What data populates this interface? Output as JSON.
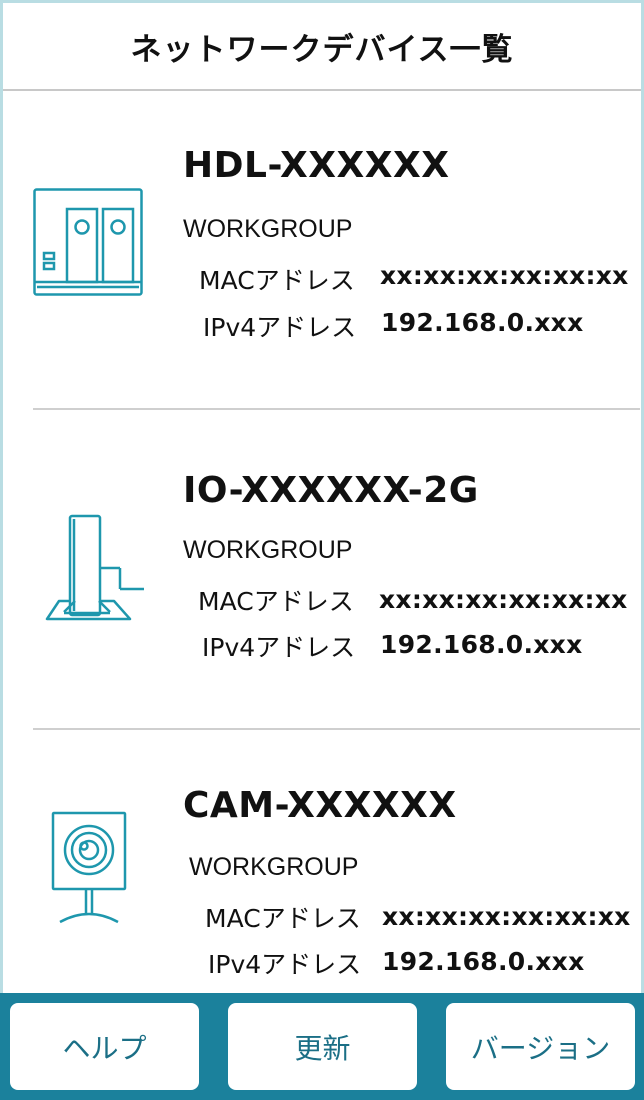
{
  "header": {
    "title": "ネットワークデバイス一覧"
  },
  "devices": [
    {
      "name": "HDL-XXXXXX",
      "group": "WORKGROUP",
      "mac_label": "MACアドレス",
      "mac": "xx:xx:xx:xx:xx:xx",
      "ip_label": "IPv4アドレス",
      "ip": "192.168.0.xxx",
      "icon": "nas-icon"
    },
    {
      "name": "IO-XXXXXX-2G",
      "group": "WORKGROUP",
      "mac_label": "MACアドレス",
      "mac": "xx:xx:xx:xx:xx:xx",
      "ip_label": "IPv4アドレス",
      "ip": "192.168.0.xxx",
      "icon": "router-icon"
    },
    {
      "name": "CAM-XXXXXX",
      "group": "WORKGROUP",
      "mac_label": "MACアドレス",
      "mac": "xx:xx:xx:xx:xx:xx",
      "ip_label": "IPv4アドレス",
      "ip": "192.168.0.xxx",
      "icon": "camera-icon"
    }
  ],
  "footer": {
    "help_label": "ヘルプ",
    "refresh_label": "更新",
    "version_label": "バージョン"
  },
  "colors": {
    "accent": "#1b819c",
    "icon": "#1e97ad",
    "frame": "#b9dde3"
  }
}
